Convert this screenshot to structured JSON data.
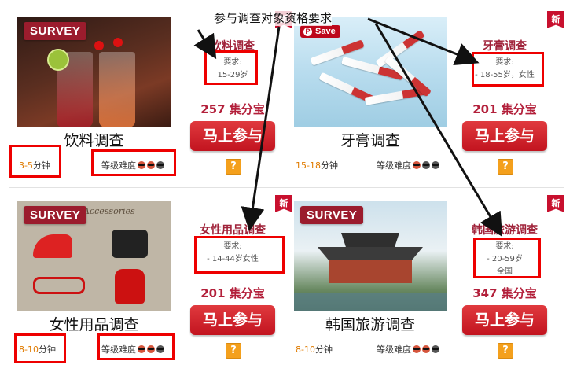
{
  "annotation": {
    "title": "参与调查对象资格要求"
  },
  "cards": [
    {
      "thumb_badge": "SURVEY",
      "thumb_title": "饮料调查",
      "time_num": "3-5",
      "time_unit": "分钟",
      "level_label": "等级难度",
      "survey_name": "饮料调查",
      "req_label": "要求:",
      "req_value": "15-29岁",
      "req_value2": "",
      "points": "257 集分宝",
      "join_label": "马上参与",
      "help_label": "?",
      "new_label": "新"
    },
    {
      "thumb_badge": "Save",
      "thumb_title": "牙膏调查",
      "time_num": "15-18",
      "time_unit": "分钟",
      "level_label": "等级难度",
      "survey_name": "牙膏调查",
      "req_label": "要求:",
      "req_value": "- 18-55岁，女性",
      "req_value2": "",
      "points": "201 集分宝",
      "join_label": "马上参与",
      "help_label": "?",
      "new_label": "新"
    },
    {
      "thumb_badge": "SURVEY",
      "thumb_caption": "Accessories",
      "thumb_title": "女性用品调查",
      "time_num": "8-10",
      "time_unit": "分钟",
      "level_label": "等级难度",
      "survey_name": "女性用品调查",
      "req_label": "要求:",
      "req_value": "- 14-44岁女性",
      "req_value2": "",
      "points": "201 集分宝",
      "join_label": "马上参与",
      "help_label": "?",
      "new_label": "新"
    },
    {
      "thumb_badge": "SURVEY",
      "thumb_title": "韩国旅游调查",
      "time_num": "8-10",
      "time_unit": "分钟",
      "level_label": "等级难度",
      "survey_name": "韩国旅游调查",
      "req_label": "要求:",
      "req_value": "- 20-59岁",
      "req_value2": "全国",
      "points": "347 集分宝",
      "join_label": "马上参与",
      "help_label": "?",
      "new_label": "新"
    }
  ],
  "colors": {
    "accent_red": "#c2141f",
    "title_red": "#a0233a",
    "highlight_red": "#ee0000",
    "time_orange": "#e07b00",
    "help_orange": "#f4a01c"
  }
}
